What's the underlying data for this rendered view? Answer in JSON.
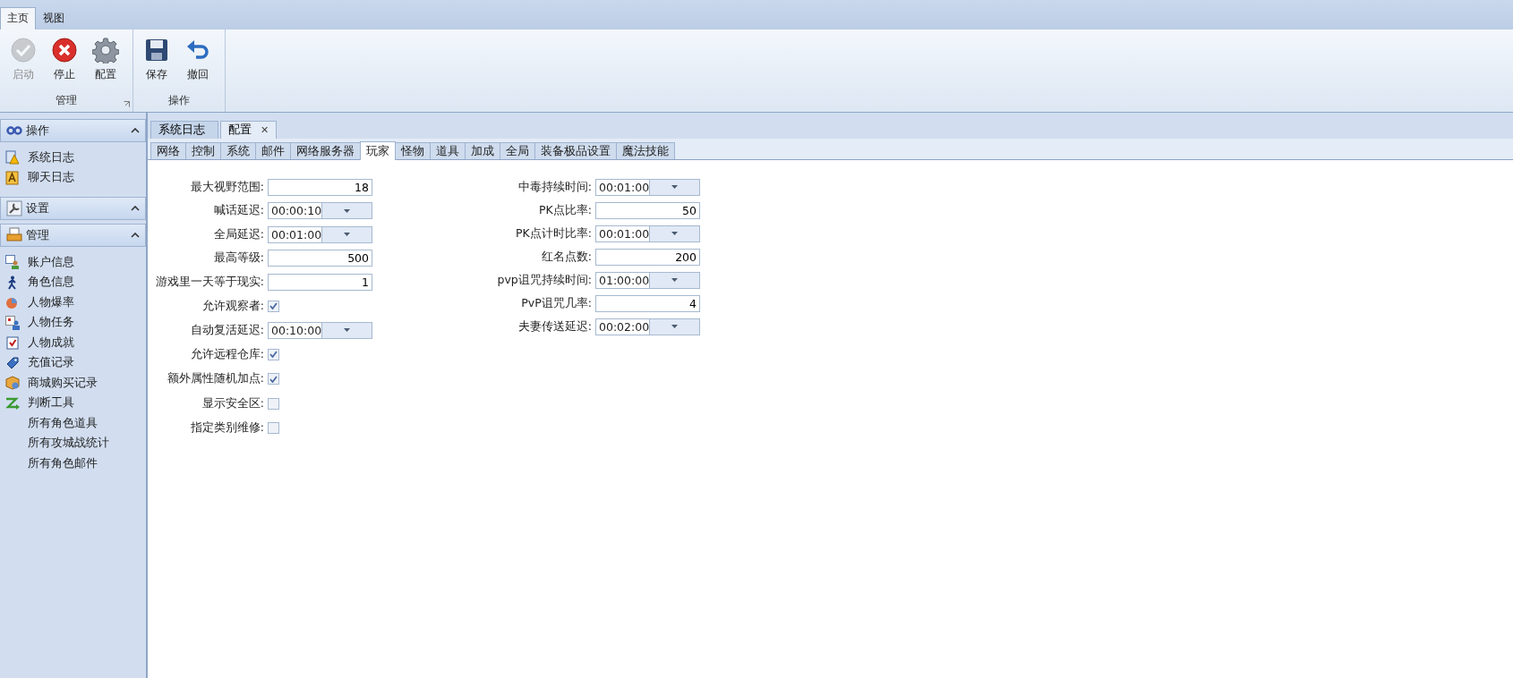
{
  "ribbon": {
    "tabs": [
      {
        "label": "主页",
        "selected": true
      },
      {
        "label": "视图",
        "selected": false
      }
    ],
    "groups": [
      {
        "label": "管理",
        "launcher": true,
        "buttons": [
          {
            "label": "启动",
            "disabled": true
          },
          {
            "label": "停止",
            "disabled": false
          },
          {
            "label": "配置",
            "disabled": false
          }
        ]
      },
      {
        "label": "操作",
        "launcher": false,
        "buttons": [
          {
            "label": "保存",
            "disabled": false
          },
          {
            "label": "撤回",
            "disabled": false
          }
        ]
      }
    ]
  },
  "sidebar": {
    "sections": [
      {
        "title": "操作",
        "expanded": true,
        "items": [
          {
            "label": "系统日志"
          },
          {
            "label": "聊天日志"
          }
        ]
      },
      {
        "title": "设置",
        "expanded": true
      },
      {
        "title": "管理",
        "expanded": true,
        "items": [
          {
            "label": "账户信息"
          },
          {
            "label": "角色信息"
          },
          {
            "label": "人物爆率"
          },
          {
            "label": "人物任务"
          },
          {
            "label": "人物成就"
          },
          {
            "label": "充值记录"
          },
          {
            "label": "商城购买记录"
          },
          {
            "label": "判断工具"
          },
          {
            "label": "所有角色道具"
          },
          {
            "label": "所有攻城战统计"
          },
          {
            "label": "所有角色邮件"
          }
        ]
      }
    ]
  },
  "doc_tabs": [
    {
      "label": "系统日志",
      "selected": false,
      "closable": false
    },
    {
      "label": "配置",
      "selected": true,
      "closable": true
    }
  ],
  "close_glyph": "✕",
  "sub_tabs": [
    {
      "label": "网络",
      "selected": false
    },
    {
      "label": "控制",
      "selected": false
    },
    {
      "label": "系统",
      "selected": false
    },
    {
      "label": "邮件",
      "selected": false
    },
    {
      "label": "网络服务器",
      "selected": false
    },
    {
      "label": "玩家",
      "selected": true
    },
    {
      "label": "怪物",
      "selected": false
    },
    {
      "label": "道具",
      "selected": false
    },
    {
      "label": "加成",
      "selected": false
    },
    {
      "label": "全局",
      "selected": false
    },
    {
      "label": "装备极品设置",
      "selected": false
    },
    {
      "label": "魔法技能",
      "selected": false
    }
  ],
  "form": {
    "left": [
      {
        "kind": "number",
        "label": "最大视野范围:",
        "value": "18"
      },
      {
        "kind": "time",
        "label": "喊话延迟:",
        "value": "00:00:10"
      },
      {
        "kind": "time",
        "label": "全局延迟:",
        "value": "00:01:00"
      },
      {
        "kind": "number",
        "label": "最高等级:",
        "value": "500"
      },
      {
        "kind": "number",
        "label": "游戏里一天等于现实:",
        "value": "1"
      },
      {
        "kind": "checkbox",
        "label": "允许观察者:",
        "checked": true
      },
      {
        "kind": "time",
        "label": "自动复活延迟:",
        "value": "00:10:00"
      },
      {
        "kind": "checkbox",
        "label": "允许远程仓库:",
        "checked": true
      },
      {
        "kind": "checkbox",
        "label": "额外属性随机加点:",
        "checked": true
      },
      {
        "kind": "checkbox",
        "label": "显示安全区:",
        "checked": false
      },
      {
        "kind": "checkbox",
        "label": "指定类别维修:",
        "checked": false
      }
    ],
    "right": [
      {
        "kind": "time",
        "label": "中毒持续时间:",
        "value": "00:01:00"
      },
      {
        "kind": "number",
        "label": "PK点比率:",
        "value": "50"
      },
      {
        "kind": "time",
        "label": "PK点计时比率:",
        "value": "00:01:00"
      },
      {
        "kind": "number",
        "label": "红名点数:",
        "value": "200"
      },
      {
        "kind": "time",
        "label": "pvp诅咒持续时间:",
        "value": "01:00:00"
      },
      {
        "kind": "number",
        "label": "PvP诅咒几率:",
        "value": "4"
      },
      {
        "kind": "time",
        "label": "夫妻传送延迟:",
        "value": "00:02:00"
      }
    ]
  }
}
